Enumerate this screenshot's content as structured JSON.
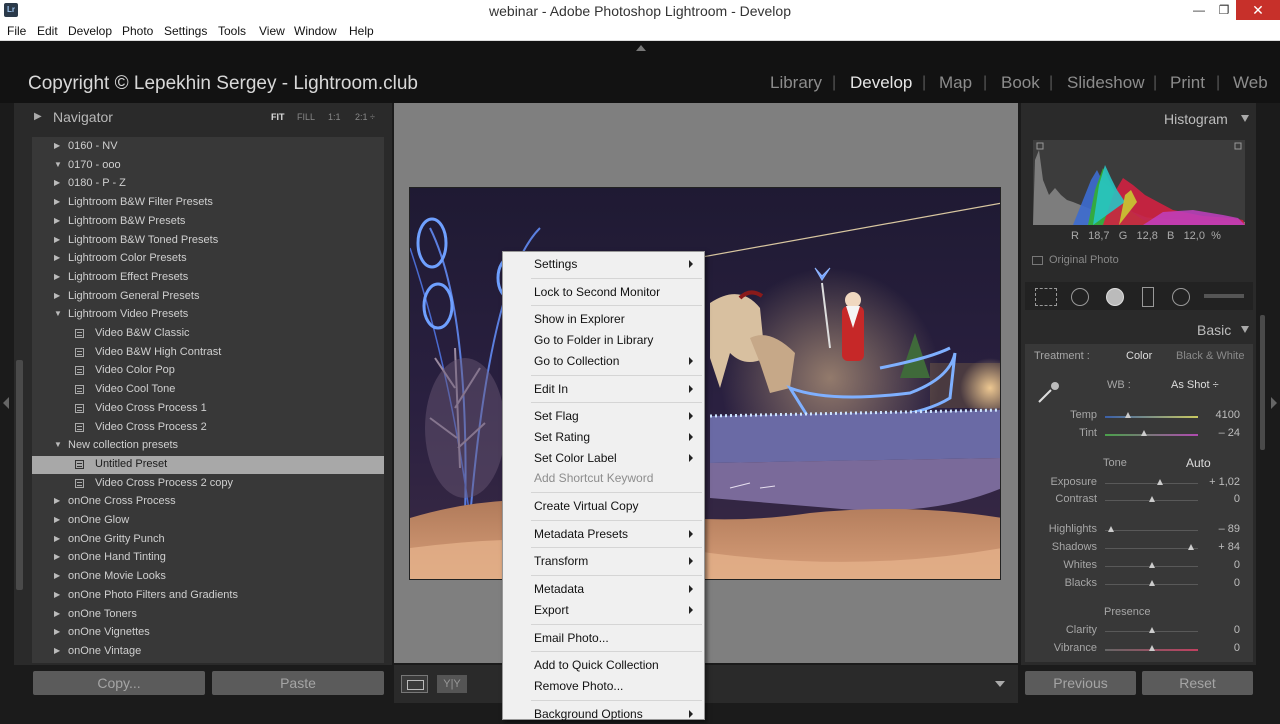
{
  "window": {
    "app_icon": "Lr",
    "title": "webinar - Adobe Photoshop Lightroom - Develop",
    "minimize_icon": "minimize-icon",
    "maximize_icon": "maximize-icon",
    "close_icon": "close-icon"
  },
  "menubar": [
    "File",
    "Edit",
    "Develop",
    "Photo",
    "Settings",
    "Tools",
    "View",
    "Window",
    "Help"
  ],
  "identity_plate": "Copyright © Lepekhin Sergey - Lightroom.club",
  "modules": [
    "Library",
    "Develop",
    "Map",
    "Book",
    "Slideshow",
    "Print",
    "Web"
  ],
  "active_module": "Develop",
  "navigator": {
    "label": "Navigator",
    "zoom": [
      "FIT",
      "FILL",
      "1:1",
      "2:1 ÷"
    ],
    "active_zoom": "FIT"
  },
  "presets": [
    {
      "label": "0160 - NV",
      "type": "folder",
      "expanded": false
    },
    {
      "label": "0170 - ooo",
      "type": "folder",
      "expanded": true
    },
    {
      "label": "0180 - P - Z",
      "type": "folder",
      "expanded": false
    },
    {
      "label": "Lightroom B&W Filter Presets",
      "type": "folder",
      "expanded": false
    },
    {
      "label": "Lightroom B&W Presets",
      "type": "folder",
      "expanded": false
    },
    {
      "label": "Lightroom B&W Toned Presets",
      "type": "folder",
      "expanded": false
    },
    {
      "label": "Lightroom Color Presets",
      "type": "folder",
      "expanded": false
    },
    {
      "label": "Lightroom Effect Presets",
      "type": "folder",
      "expanded": false
    },
    {
      "label": "Lightroom General Presets",
      "type": "folder",
      "expanded": false
    },
    {
      "label": "Lightroom Video Presets",
      "type": "folder",
      "expanded": true
    },
    {
      "label": "Video B&W Classic",
      "type": "preset"
    },
    {
      "label": "Video B&W High Contrast",
      "type": "preset"
    },
    {
      "label": "Video Color Pop",
      "type": "preset"
    },
    {
      "label": "Video Cool Tone",
      "type": "preset"
    },
    {
      "label": "Video Cross Process 1",
      "type": "preset"
    },
    {
      "label": "Video Cross Process 2",
      "type": "preset"
    },
    {
      "label": "New collection presets",
      "type": "folder",
      "expanded": true
    },
    {
      "label": "Untitled Preset",
      "type": "preset",
      "selected": true
    },
    {
      "label": "Video Cross Process 2 copy",
      "type": "preset"
    },
    {
      "label": "onOne Cross Process",
      "type": "folder",
      "expanded": false
    },
    {
      "label": "onOne Glow",
      "type": "folder",
      "expanded": false
    },
    {
      "label": "onOne Gritty Punch",
      "type": "folder",
      "expanded": false
    },
    {
      "label": "onOne Hand Tinting",
      "type": "folder",
      "expanded": false
    },
    {
      "label": "onOne Movie Looks",
      "type": "folder",
      "expanded": false
    },
    {
      "label": "onOne Photo Filters and Gradients",
      "type": "folder",
      "expanded": false
    },
    {
      "label": "onOne Toners",
      "type": "folder",
      "expanded": false
    },
    {
      "label": "onOne Vignettes",
      "type": "folder",
      "expanded": false
    },
    {
      "label": "onOne Vintage",
      "type": "folder",
      "expanded": false
    }
  ],
  "left_buttons": {
    "copy": "Copy...",
    "paste": "Paste"
  },
  "toolbar": {
    "yy": "Y|Y"
  },
  "context_menu": [
    {
      "label": "Settings",
      "submenu": true
    },
    {
      "sep": true
    },
    {
      "label": "Lock to Second Monitor"
    },
    {
      "sep": true
    },
    {
      "label": "Show in Explorer"
    },
    {
      "label": "Go to Folder in Library"
    },
    {
      "label": "Go to Collection",
      "submenu": true
    },
    {
      "sep": true
    },
    {
      "label": "Edit In",
      "submenu": true
    },
    {
      "sep": true
    },
    {
      "label": "Set Flag",
      "submenu": true
    },
    {
      "label": "Set Rating",
      "submenu": true
    },
    {
      "label": "Set Color Label",
      "submenu": true
    },
    {
      "label": "Add Shortcut Keyword",
      "disabled": true
    },
    {
      "sep": true
    },
    {
      "label": "Create Virtual Copy"
    },
    {
      "sep": true
    },
    {
      "label": "Metadata Presets",
      "submenu": true
    },
    {
      "sep": true
    },
    {
      "label": "Transform",
      "submenu": true
    },
    {
      "sep": true
    },
    {
      "label": "Metadata",
      "submenu": true
    },
    {
      "label": "Export",
      "submenu": true
    },
    {
      "sep": true
    },
    {
      "label": "Email Photo..."
    },
    {
      "sep": true
    },
    {
      "label": "Add to Quick Collection"
    },
    {
      "label": "Remove Photo..."
    },
    {
      "sep": true
    },
    {
      "label": "Background Options",
      "submenu": true
    }
  ],
  "histogram": {
    "label": "Histogram",
    "readout": {
      "r_label": "R",
      "r": "18,7",
      "g_label": "G",
      "g": "12,8",
      "b_label": "B",
      "b": "12,0",
      "unit": "%"
    },
    "original_photo": "Original Photo"
  },
  "basic": {
    "label": "Basic",
    "treatment_label": "Treatment :",
    "color": "Color",
    "bw": "Black & White",
    "wb_label": "WB :",
    "wb_value": "As Shot ÷",
    "tone_label": "Tone",
    "auto": "Auto",
    "presence_label": "Presence",
    "sliders": [
      {
        "label": "Temp",
        "value": "4100",
        "pos": 0.25
      },
      {
        "label": "Tint",
        "value": "– 24",
        "pos": 0.42
      },
      {
        "label": "Exposure",
        "value": "+ 1,02",
        "pos": 0.59
      },
      {
        "label": "Contrast",
        "value": "0",
        "pos": 0.5
      },
      {
        "label": "Highlights",
        "value": "– 89",
        "pos": 0.06
      },
      {
        "label": "Shadows",
        "value": "+ 84",
        "pos": 0.92
      },
      {
        "label": "Whites",
        "value": "0",
        "pos": 0.5
      },
      {
        "label": "Blacks",
        "value": "0",
        "pos": 0.5
      },
      {
        "label": "Clarity",
        "value": "0",
        "pos": 0.5
      },
      {
        "label": "Vibrance",
        "value": "0",
        "pos": 0.5
      }
    ]
  },
  "right_buttons": {
    "previous": "Previous",
    "reset": "Reset"
  },
  "colors": {
    "accent_selected": "#a8a8a8",
    "panel": "#383838",
    "background": "#7f7f7f"
  }
}
